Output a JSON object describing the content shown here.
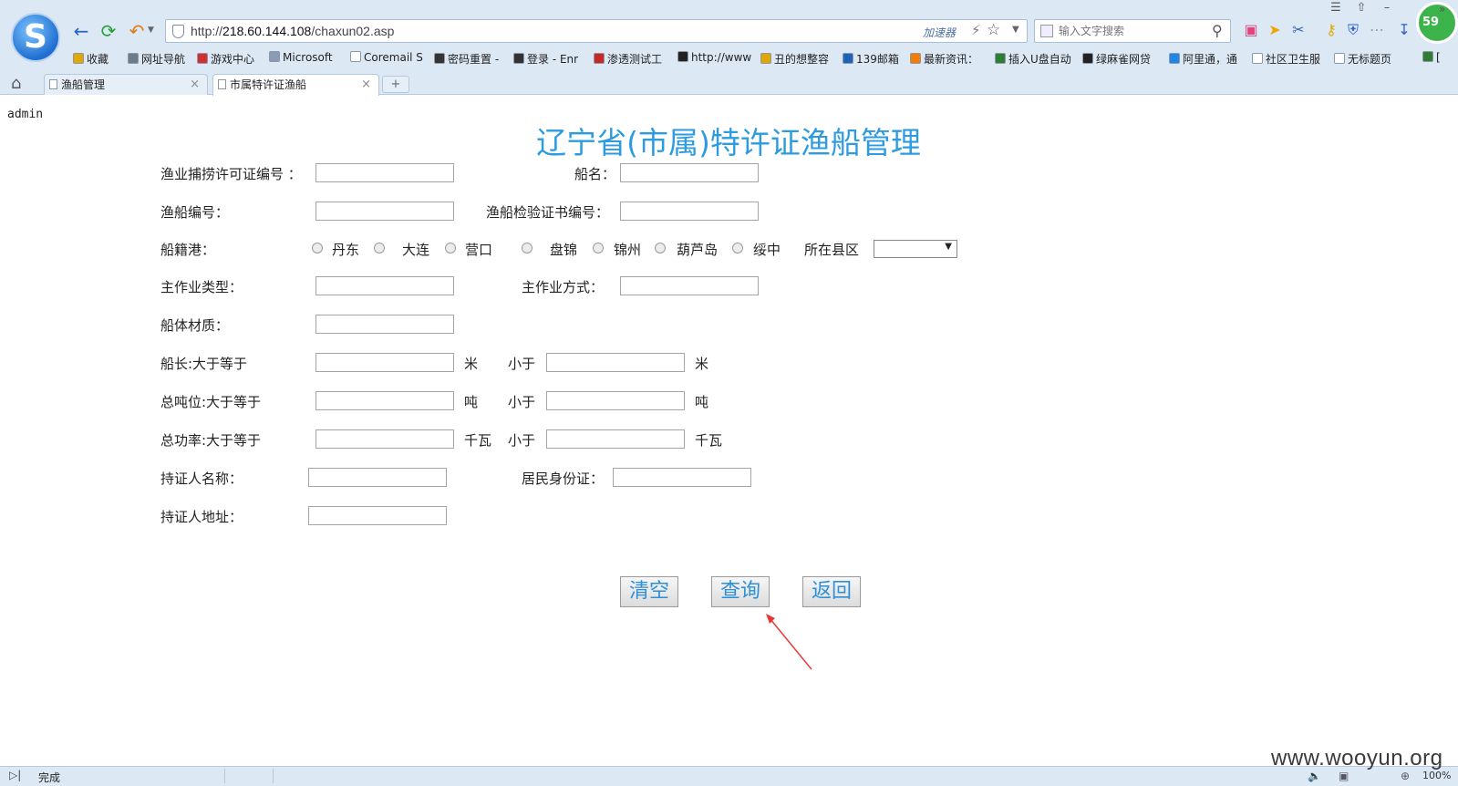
{
  "browser": {
    "address_url_prefix": "http://",
    "address_host": "218.60.144.108",
    "address_path": "/chaxun02.asp",
    "accelerator_label": "加速器",
    "search_placeholder": "输入文字搜索",
    "badge_count": "59",
    "logo_letter": "S"
  },
  "bookmarks": [
    {
      "label": "收藏",
      "icon": "star-icon",
      "color": "#e0a800"
    },
    {
      "label": "网址导航",
      "icon": "globe-icon",
      "color": "#6b7b8c"
    },
    {
      "label": "游戏中心",
      "icon": "game-icon",
      "color": "#d32f2f"
    },
    {
      "label": "Microsoft",
      "icon": "folder-icon",
      "color": "#8a9bb3"
    },
    {
      "label": "Coremail S",
      "icon": "page-icon",
      "color": "#ffffff"
    },
    {
      "label": "密码重置 -",
      "icon": "site-icon",
      "color": "#333333"
    },
    {
      "label": "登录 - Enr",
      "icon": "site-icon",
      "color": "#333333"
    },
    {
      "label": "渗透测试工",
      "icon": "c-icon",
      "color": "#c62828"
    },
    {
      "label": "http://www",
      "icon": "site-icon",
      "color": "#222222"
    },
    {
      "label": "丑的想整容",
      "icon": "star-icon",
      "color": "#e0a800"
    },
    {
      "label": "139邮箱",
      "icon": "mail-icon",
      "color": "#1e63b8"
    },
    {
      "label": "最新资讯：",
      "icon": "news-icon",
      "color": "#f57c00"
    },
    {
      "label": "插入U盘自动",
      "icon": "f-icon",
      "color": "#2e7d32"
    },
    {
      "label": "绿麻雀网贷",
      "icon": "site-icon",
      "color": "#222222"
    },
    {
      "label": "阿里通，通",
      "icon": "ali-icon",
      "color": "#1e88e5"
    },
    {
      "label": "社区卫生服",
      "icon": "page-icon",
      "color": "#ffffff"
    },
    {
      "label": "无标题页",
      "icon": "page-icon",
      "color": "#ffffff"
    },
    {
      "label": "[",
      "icon": "site-icon",
      "color": "#2e7d32"
    }
  ],
  "tabs": [
    {
      "label": "渔船管理",
      "active": false
    },
    {
      "label": "市属特许证渔船",
      "active": true
    }
  ],
  "page": {
    "user": "admin",
    "title": "辽宁省(市属)特许证渔船管理"
  },
  "form": {
    "license_no_label": "渔业捕捞许可证编号 ：",
    "ship_name_label": "船名：",
    "ship_no_label": "渔船编号：",
    "inspection_cert_label": "渔船检验证书编号：",
    "port_label": "船籍港：",
    "ports": [
      "丹东",
      "大连",
      "营口",
      "盘锦",
      "锦州",
      "葫芦岛",
      "绥中"
    ],
    "county_label": "所在县区",
    "county_value": "",
    "work_type_label": "主作业类型：",
    "work_mode_label": "主作业方式：",
    "hull_material_label": "船体材质：",
    "length_label": "船长:大于等于",
    "length_unit": "米",
    "tonnage_label": "总吨位:大于等于",
    "tonnage_unit": "吨",
    "power_label": "总功率:大于等于",
    "power_unit": "千瓦",
    "less_than_label": "小于",
    "holder_name_label": "持证人名称：",
    "id_card_label": "居民身份证：",
    "holder_address_label": "持证人地址："
  },
  "buttons": {
    "clear": "清空",
    "query": "查询",
    "back": "返回"
  },
  "status": {
    "text": "完成",
    "zoom": "100%"
  },
  "watermark": "www.wooyun.org",
  "colors": {
    "title": "#2d9be0",
    "button_text": "#2d8fd8",
    "arrow": "#e53935"
  }
}
